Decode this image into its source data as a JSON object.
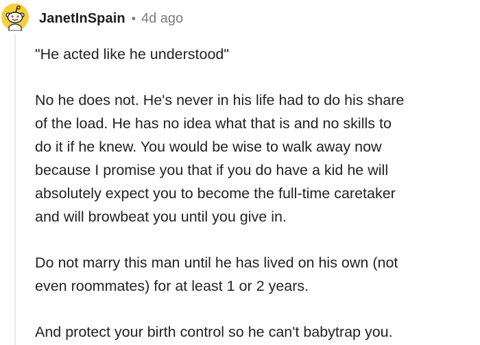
{
  "comment": {
    "author": "JanetInSpain",
    "separator": "•",
    "time": "4d ago",
    "paragraphs": [
      "\"He acted like he understood\"",
      "No he does not. He's never in his life had to do his share\nof the load. He has no idea what that is and no skills to\ndo it if he knew. You would be wise to walk away now\nbecause I promise you that if you do have a kid he will\nabsolutely expect you to become the full-time caretaker\nand will browbeat you until you give in.",
      "Do not marry this man until he has lived on his own (not\neven roommates) for at least 1 or 2 years.",
      "And protect your birth control so he can't babytrap you."
    ]
  },
  "avatar": {
    "icon": "snoo-avatar-icon",
    "bg_color": "#f6cf39",
    "face_color": "#1c1c1c"
  },
  "colors": {
    "text": "#222222",
    "meta": "#7c7c7c",
    "thread_line": "#e6e8ea"
  }
}
